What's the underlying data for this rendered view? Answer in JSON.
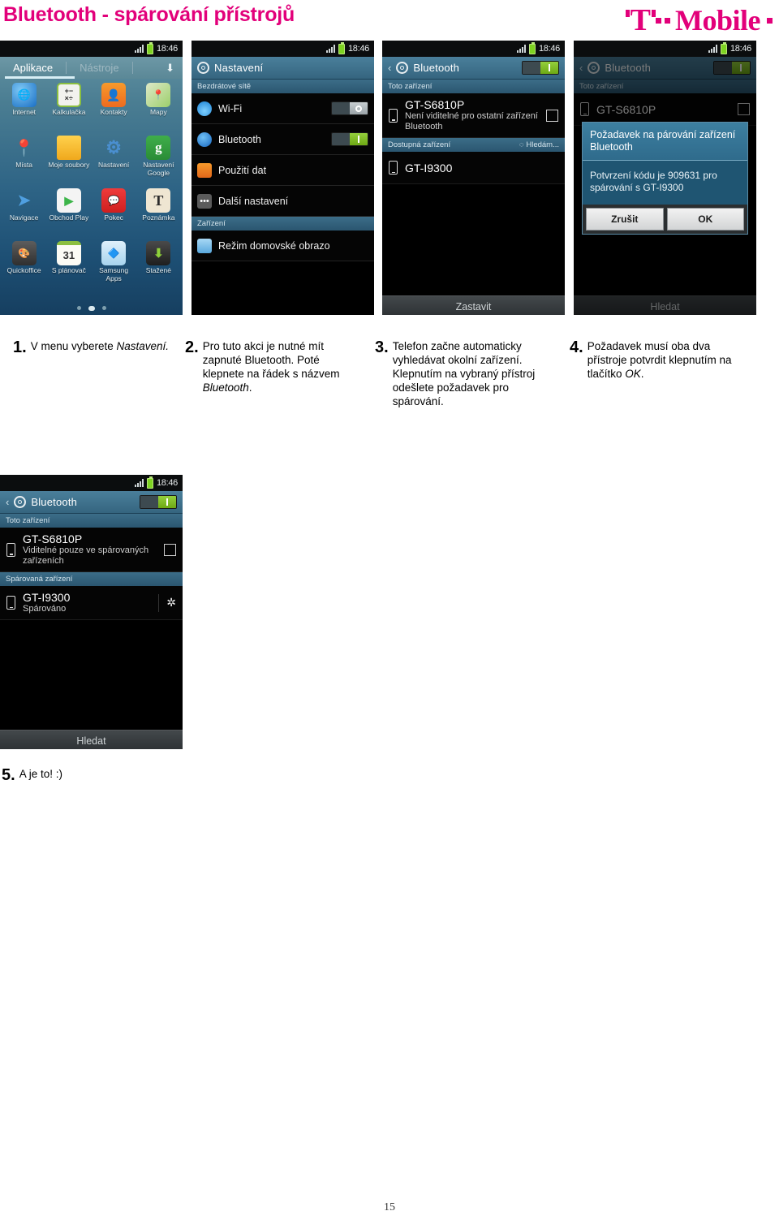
{
  "header": {
    "title": "Bluetooth - spárování přístrojů",
    "brand": {
      "letter": "T",
      "word": "Mobile"
    },
    "accent_color": "#e2007a"
  },
  "status_bar": {
    "time": "18:46"
  },
  "phone1": {
    "tabs": [
      {
        "label": "Aplikace",
        "active": true
      },
      {
        "label": "Nástroje",
        "active": false
      }
    ],
    "download_icon": "download-icon",
    "apps": [
      {
        "label": "Internet",
        "icon": "globe-icon"
      },
      {
        "label": "Kalkulačka",
        "icon": "calculator-icon"
      },
      {
        "label": "Kontakty",
        "icon": "person-icon"
      },
      {
        "label": "Mapy",
        "icon": "map-pin-icon"
      },
      {
        "label": "Místa",
        "icon": "place-marker-icon"
      },
      {
        "label": "Moje soubory",
        "icon": "folder-icon"
      },
      {
        "label": "Nastavení",
        "icon": "gear-icon"
      },
      {
        "label": "Nastavení Google",
        "icon": "google-g-icon"
      },
      {
        "label": "Navigace",
        "icon": "navigation-arrow-icon"
      },
      {
        "label": "Obchod Play",
        "icon": "play-store-icon"
      },
      {
        "label": "Pokec",
        "icon": "chat-bubble-icon"
      },
      {
        "label": "Poznámka",
        "icon": "note-t-icon"
      },
      {
        "label": "Quickoffice",
        "icon": "quickoffice-icon"
      },
      {
        "label": "S plánovač",
        "icon": "calendar-31-icon"
      },
      {
        "label": "Samsung Apps",
        "icon": "samsung-apps-icon"
      },
      {
        "label": "Stažené",
        "icon": "downloads-arrow-icon"
      }
    ],
    "page_dots": {
      "count": 3,
      "active_index": 1
    }
  },
  "phone2": {
    "header_title": "Nastavení",
    "sections": [
      {
        "title": "Bezdrátové sítě",
        "rows": [
          {
            "label": "Wi-Fi",
            "icon": "wifi-icon",
            "toggle": "off"
          },
          {
            "label": "Bluetooth",
            "icon": "bluetooth-icon",
            "toggle": "on"
          },
          {
            "label": "Použití dat",
            "icon": "data-usage-icon",
            "toggle": null
          },
          {
            "label": "Další nastavení",
            "icon": "more-dots-icon",
            "toggle": null
          }
        ]
      },
      {
        "title": "Zařízení",
        "rows": [
          {
            "label": "Režim domovské obrazo",
            "icon": "home-screen-icon",
            "toggle": null
          }
        ]
      }
    ]
  },
  "phone3": {
    "header_title": "Bluetooth",
    "toggle": "on",
    "section_this_device": "Toto zařízení",
    "this_device": {
      "name": "GT-S6810P",
      "sub": "Není viditelné pro ostatní zařízení Bluetooth",
      "checkbox": "unchecked"
    },
    "section_available": "Dostupná zařízení",
    "scanning_label": "Hledám...",
    "available_devices": [
      {
        "name": "GT-I9300"
      }
    ],
    "footer_button": "Zastavit"
  },
  "phone4": {
    "header_title": "Bluetooth",
    "section_this_device": "Toto zařízení",
    "this_device_name": "GT-S6810P",
    "dialog": {
      "title": "Požadavek na párování zařízení Bluetooth",
      "message": "Potvrzení kódu je 909631 pro spárování s GT-I9300",
      "cancel_label": "Zrušit",
      "ok_label": "OK"
    },
    "footer_button": "Hledat"
  },
  "phone5": {
    "header_title": "Bluetooth",
    "toggle": "on",
    "section_this_device": "Toto zařízení",
    "this_device": {
      "name": "GT-S6810P",
      "sub": "Viditelné pouze ve spárovaných zařízeních",
      "checkbox": "unchecked"
    },
    "section_paired": "Spárovaná zařízení",
    "paired_devices": [
      {
        "name": "GT-I9300",
        "status": "Spárováno"
      }
    ],
    "footer_button": "Hledat"
  },
  "captions": [
    {
      "num": "1.",
      "parts": [
        {
          "t": "V menu vyberete "
        },
        {
          "t": "Nastavení.",
          "em": true
        }
      ]
    },
    {
      "num": "2.",
      "parts": [
        {
          "t": "Pro tuto akci je nutné mít zapnuté Bluetooth. Poté klepnete na řádek s názvem "
        },
        {
          "t": "Bluetooth",
          "em": true
        },
        {
          "t": "."
        }
      ]
    },
    {
      "num": "3.",
      "parts": [
        {
          "t": "Telefon začne automaticky vyhledávat okolní zařízení. Klepnutím na vybraný přístroj odešlete požadavek pro spárování."
        }
      ]
    },
    {
      "num": "4.",
      "parts": [
        {
          "t": "Požadavek musí oba dva přístroje potvrdit klepnutím na tlačítko "
        },
        {
          "t": "OK",
          "em": true
        },
        {
          "t": "."
        }
      ]
    },
    {
      "num": "5.",
      "parts": [
        {
          "t": "A je to! :)"
        }
      ]
    }
  ],
  "page_number": "15"
}
